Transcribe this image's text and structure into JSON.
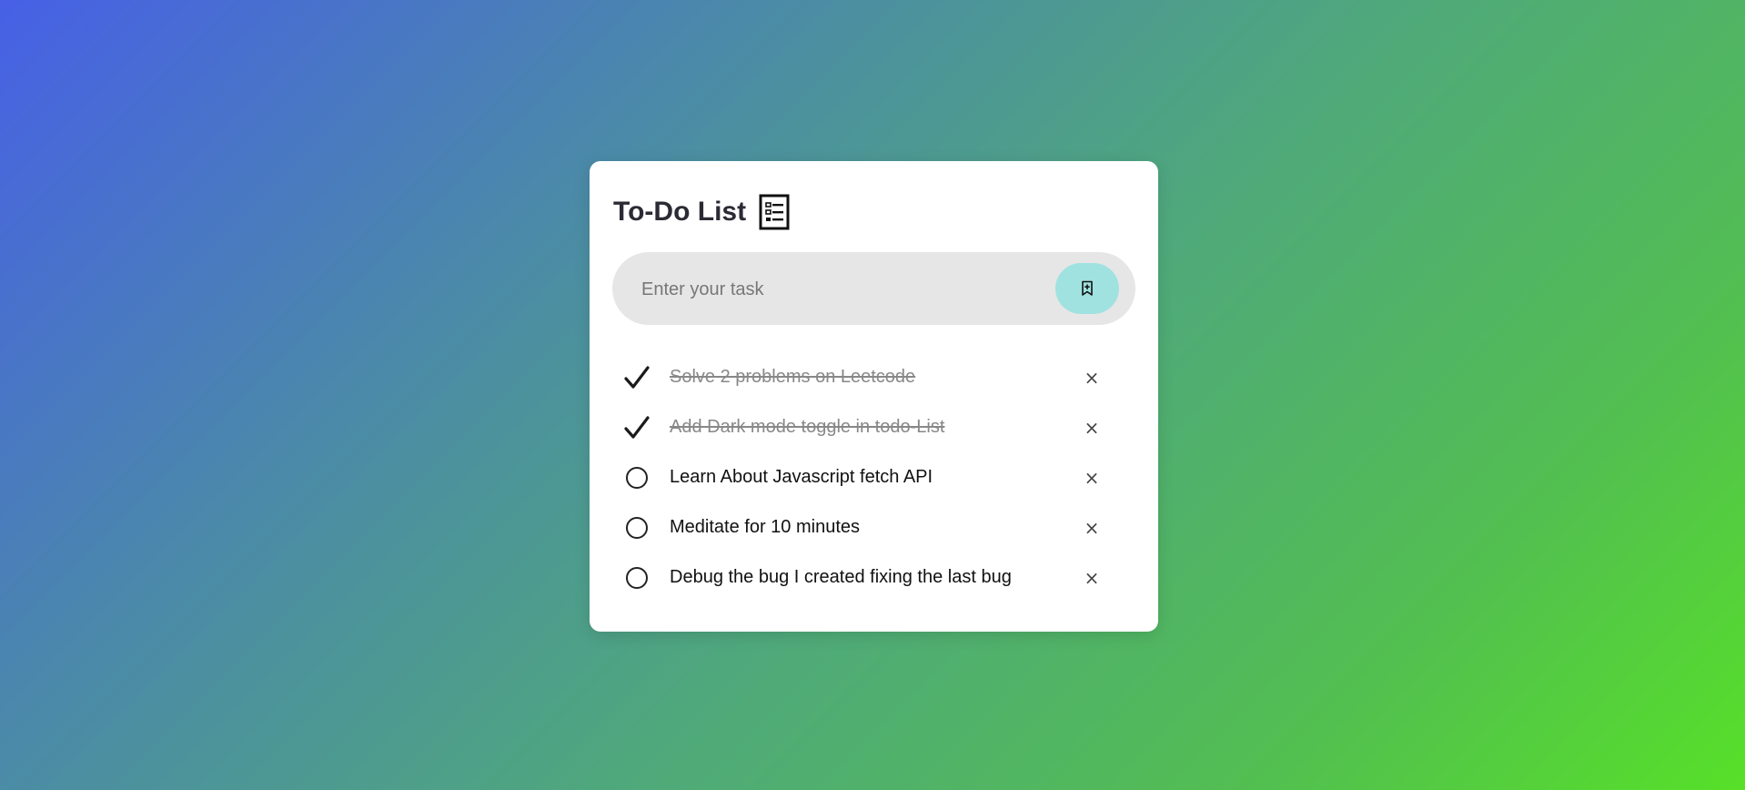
{
  "app": {
    "title": "To-Do List",
    "title_icon": "checklist-icon"
  },
  "input": {
    "placeholder": "Enter your task",
    "value": "",
    "add_icon": "bookmark-add-icon"
  },
  "colors": {
    "gradient_start": "#4760e6",
    "gradient_end": "#57e028",
    "card_bg": "#ffffff",
    "input_bg": "#e6e6e6",
    "add_button_bg": "#a0e2e0",
    "done_text": "#888888"
  },
  "tasks": [
    {
      "text": "Solve 2 problems on Leetcode",
      "done": true,
      "delete_icon": "close-icon",
      "delete_label": "×"
    },
    {
      "text": "Add Dark mode toggle in todo-List",
      "done": true,
      "delete_icon": "close-icon",
      "delete_label": "×"
    },
    {
      "text": "Learn About Javascript fetch API",
      "done": false,
      "delete_icon": "close-icon",
      "delete_label": "×"
    },
    {
      "text": "Meditate for 10 minutes",
      "done": false,
      "delete_icon": "close-icon",
      "delete_label": "×"
    },
    {
      "text": "Debug the bug I created fixing the last bug",
      "done": false,
      "delete_icon": "close-icon",
      "delete_label": "×"
    }
  ]
}
